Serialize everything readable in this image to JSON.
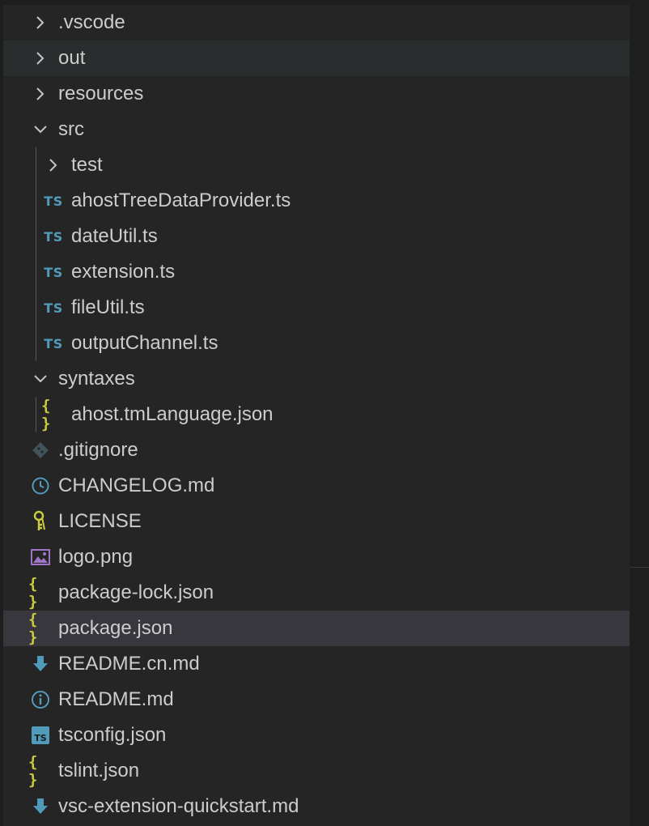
{
  "explorer": {
    "rows": [
      {
        "kind": "folder",
        "label": ".vscode",
        "expanded": false,
        "depth": 0,
        "icon": "chevron-right-icon"
      },
      {
        "kind": "folder",
        "label": "out",
        "expanded": false,
        "depth": 0,
        "icon": "chevron-right-icon",
        "state": "hover"
      },
      {
        "kind": "folder",
        "label": "resources",
        "expanded": false,
        "depth": 0,
        "icon": "chevron-right-icon"
      },
      {
        "kind": "folder",
        "label": "src",
        "expanded": true,
        "depth": 0,
        "icon": "chevron-down-icon"
      },
      {
        "kind": "folder",
        "label": "test",
        "expanded": false,
        "depth": 1,
        "icon": "chevron-right-icon"
      },
      {
        "kind": "file",
        "label": "ahostTreeDataProvider.ts",
        "depth": 1,
        "icon": "typescript-icon"
      },
      {
        "kind": "file",
        "label": "dateUtil.ts",
        "depth": 1,
        "icon": "typescript-icon"
      },
      {
        "kind": "file",
        "label": "extension.ts",
        "depth": 1,
        "icon": "typescript-icon"
      },
      {
        "kind": "file",
        "label": "fileUtil.ts",
        "depth": 1,
        "icon": "typescript-icon"
      },
      {
        "kind": "file",
        "label": "outputChannel.ts",
        "depth": 1,
        "icon": "typescript-icon"
      },
      {
        "kind": "folder",
        "label": "syntaxes",
        "expanded": true,
        "depth": 0,
        "icon": "chevron-down-icon"
      },
      {
        "kind": "file",
        "label": "ahost.tmLanguage.json",
        "depth": 1,
        "icon": "json-icon"
      },
      {
        "kind": "file",
        "label": ".gitignore",
        "depth": 0,
        "icon": "git-icon"
      },
      {
        "kind": "file",
        "label": "CHANGELOG.md",
        "depth": 0,
        "icon": "clock-icon"
      },
      {
        "kind": "file",
        "label": "LICENSE",
        "depth": 0,
        "icon": "license-key-icon"
      },
      {
        "kind": "file",
        "label": "logo.png",
        "depth": 0,
        "icon": "image-icon"
      },
      {
        "kind": "file",
        "label": "package-lock.json",
        "depth": 0,
        "icon": "json-icon"
      },
      {
        "kind": "file",
        "label": "package.json",
        "depth": 0,
        "icon": "json-icon",
        "state": "selected"
      },
      {
        "kind": "file",
        "label": "README.cn.md",
        "depth": 0,
        "icon": "download-arrow-icon"
      },
      {
        "kind": "file",
        "label": "README.md",
        "depth": 0,
        "icon": "info-icon"
      },
      {
        "kind": "file",
        "label": "tsconfig.json",
        "depth": 0,
        "icon": "tsconfig-icon"
      },
      {
        "kind": "file",
        "label": "tslint.json",
        "depth": 0,
        "icon": "json-icon"
      },
      {
        "kind": "file",
        "label": "vsc-extension-quickstart.md",
        "depth": 0,
        "icon": "download-arrow-icon"
      }
    ],
    "icon_text": {
      "typescript": "TS",
      "json": "{ }"
    },
    "colors": {
      "background": "#252526",
      "hover": "#2a2d2e",
      "selected": "#37373d",
      "text": "#cccccc",
      "typescript": "#519aba",
      "json": "#cbcb41",
      "git": "#41535b",
      "info": "#519aba",
      "license": "#cbcb41",
      "image": "#a074c4"
    }
  }
}
